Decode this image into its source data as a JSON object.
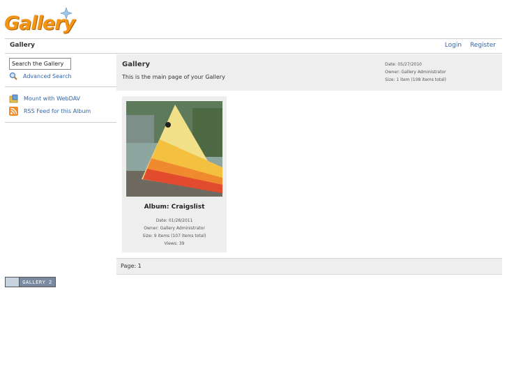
{
  "logo": {
    "text": "Gallery"
  },
  "header": {
    "breadcrumb": "Gallery",
    "login": "Login",
    "register": "Register"
  },
  "sidebar": {
    "search_value": "Search the Gallery",
    "advanced_search": "Advanced Search",
    "mount_webdav": "Mount with WebDAV",
    "rss_feed": "RSS Feed for this Album"
  },
  "album": {
    "title": "Gallery",
    "description": "This is the main page of your Gallery",
    "date": "Date: 05/27/2010",
    "owner": "Owner: Gallery Administrator",
    "size": "Size: 1 item (108 items total)"
  },
  "item": {
    "title": "Album: Craigslist",
    "date": "Date: 01/28/2011",
    "owner": "Owner: Gallery Administrator",
    "size": "Size: 9 items (107 items total)",
    "views": "Views: 39"
  },
  "pager": {
    "label": "Page:",
    "current": "1"
  },
  "badge": {
    "text": "GALLERY 2"
  },
  "colors": {
    "link": "#3366aa",
    "logo": "#f29414",
    "panel": "#eeeeee"
  }
}
